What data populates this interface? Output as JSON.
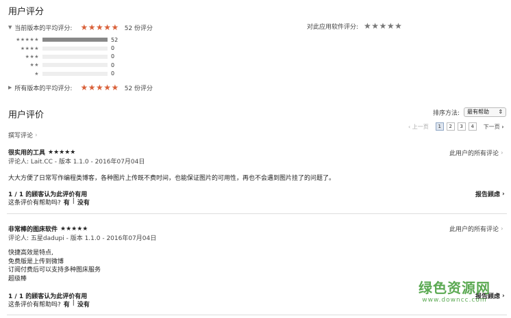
{
  "ratings": {
    "title": "用户评分",
    "current": {
      "label": "当前版本的平均评分:",
      "stars": "★★★★★",
      "count": "52 份评分"
    },
    "compare": {
      "label": "对此应用软件评分:",
      "stars": "★★★★★"
    },
    "breakdown": [
      {
        "stars": "★★★★★",
        "count": "52",
        "fraction": 1.0
      },
      {
        "stars": "★★★★",
        "count": "0",
        "fraction": 0
      },
      {
        "stars": "★★★",
        "count": "0",
        "fraction": 0
      },
      {
        "stars": "★★",
        "count": "0",
        "fraction": 0
      },
      {
        "stars": "★",
        "count": "0",
        "fraction": 0
      }
    ],
    "all_versions": {
      "label": "所有版本的平均评分:",
      "stars": "★★★★★",
      "count": "52 份评分"
    }
  },
  "reviews_section": {
    "title": "用户评价",
    "sort_label": "排序方法:",
    "sort_value": "最有帮助",
    "write_review": "撰写评论",
    "pagination": {
      "prev": "上一页",
      "pages": [
        "1",
        "2",
        "3",
        "4"
      ],
      "next": "下一页"
    }
  },
  "reviews": [
    {
      "title": "很实用的工具",
      "stars": "★★★★★",
      "reviewer_line": "评论人:  Lait.CC - 版本 1.1.0 - 2016年07月04日",
      "all_reviews_link": "此用户的所有评论",
      "body": [
        "大大方便了日常写作编程类博客，各种图片上传既不费时间，也能保证图片的可用性，再也不会遇到图片挂了的问题了。"
      ],
      "helpful_count": "1 / 1 的顾客认为此评价有用",
      "helpful_question": "这条评价有帮助吗?",
      "yes": "有",
      "divider": "|",
      "no": "没有",
      "report": "报告顾虑"
    },
    {
      "title": "非常棒的图床软件",
      "stars": "★★★★★",
      "reviewer_line": "评论人:  五星dadupi - 版本 1.1.0 - 2016年07月04日",
      "all_reviews_link": "此用户的所有评论",
      "body": [
        "快捷高效是特点,",
        "免费版是上传到微博",
        "订阅付费后可以支持多种图床服务",
        "超级棒"
      ],
      "helpful_count": "1 / 1 的顾客认为此评价有用",
      "helpful_question": "这条评价有帮助吗?",
      "yes": "有",
      "divider": "|",
      "no": "没有",
      "report": "报告顾虑"
    }
  ],
  "watermark": {
    "line1": "绿色资源网",
    "line2": "www.downcc.com"
  }
}
